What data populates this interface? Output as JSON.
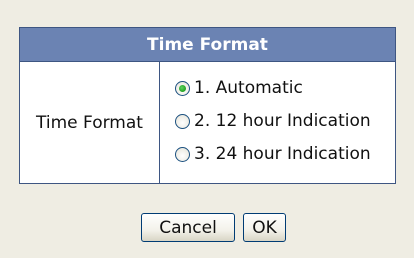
{
  "panel": {
    "title": "Time Format",
    "row_label": "Time Format",
    "options": [
      {
        "label": "1. Automatic",
        "selected": true
      },
      {
        "label": "2. 12 hour Indication",
        "selected": false
      },
      {
        "label": "3. 24 hour Indication",
        "selected": false
      }
    ]
  },
  "buttons": {
    "cancel": "Cancel",
    "ok": "OK"
  },
  "colors": {
    "header_bg": "#6b83b3",
    "border": "#3e5682",
    "page_bg": "#efede3",
    "radio_selected": "#21a121"
  }
}
